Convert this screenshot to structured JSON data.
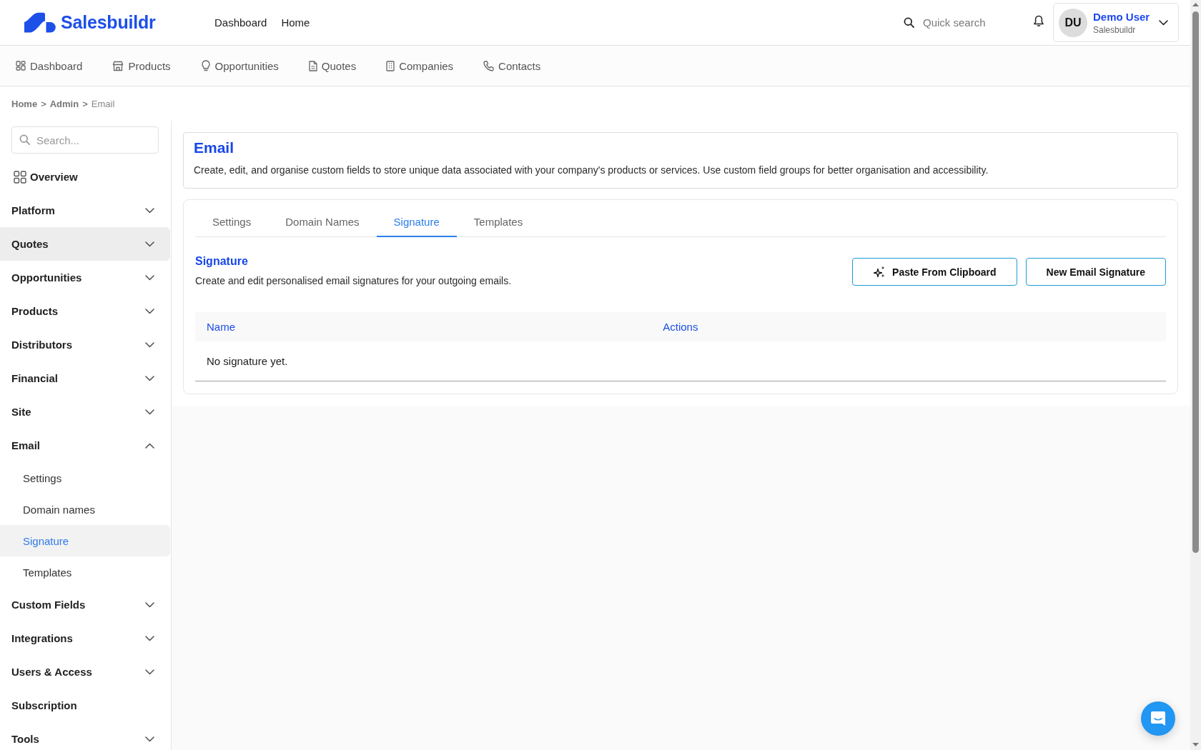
{
  "header": {
    "logo_text": "Salesbuildr",
    "nav": [
      {
        "label": "Dashboard"
      },
      {
        "label": "Home"
      }
    ],
    "search": {
      "placeholder": "Quick search"
    },
    "user": {
      "initials": "DU",
      "name": "Demo User",
      "organization": "Salesbuildr"
    }
  },
  "main_nav": [
    {
      "label": "Dashboard"
    },
    {
      "label": "Products"
    },
    {
      "label": "Opportunities"
    },
    {
      "label": "Quotes"
    },
    {
      "label": "Companies"
    },
    {
      "label": "Contacts"
    }
  ],
  "breadcrumb": [
    {
      "kind": "link",
      "text": "Home"
    },
    {
      "kind": "separator",
      "text": ">"
    },
    {
      "kind": "link",
      "text": "Admin"
    },
    {
      "kind": "separator",
      "text": ">"
    },
    {
      "kind": "current",
      "text": "Email"
    }
  ],
  "sidebar": {
    "search": {
      "placeholder": "Search..."
    },
    "overview": {
      "label": "Overview"
    },
    "items": [
      {
        "kind": "group",
        "label": "Platform",
        "expanded": false,
        "hovered": false
      },
      {
        "kind": "group",
        "label": "Quotes",
        "expanded": false,
        "hovered": true
      },
      {
        "kind": "group",
        "label": "Opportunities",
        "expanded": false,
        "hovered": false
      },
      {
        "kind": "group",
        "label": "Products",
        "expanded": false,
        "hovered": false
      },
      {
        "kind": "group",
        "label": "Distributors",
        "expanded": false,
        "hovered": false
      },
      {
        "kind": "group",
        "label": "Financial",
        "expanded": false,
        "hovered": false
      },
      {
        "kind": "group",
        "label": "Site",
        "expanded": false,
        "hovered": false
      },
      {
        "kind": "group",
        "label": "Email",
        "expanded": true,
        "hovered": false,
        "children": [
          {
            "label": "Settings",
            "selected": false
          },
          {
            "label": "Domain names",
            "selected": false
          },
          {
            "label": "Signature",
            "selected": true
          },
          {
            "label": "Templates",
            "selected": false
          }
        ]
      },
      {
        "kind": "group",
        "label": "Custom Fields",
        "expanded": false,
        "hovered": false
      },
      {
        "kind": "group",
        "label": "Integrations",
        "expanded": false,
        "hovered": false
      },
      {
        "kind": "group",
        "label": "Users & Access",
        "expanded": false,
        "hovered": false
      },
      {
        "kind": "link",
        "label": "Subscription",
        "hovered": false
      },
      {
        "kind": "group",
        "label": "Tools",
        "expanded": false,
        "hovered": false
      }
    ]
  },
  "page_header": {
    "title": "Email",
    "description": "Create, edit, and organise custom fields to store unique data associated with your company's products or services. Use custom field groups for better organisation and accessibility."
  },
  "tabs": [
    {
      "label": "Settings",
      "selected": false
    },
    {
      "label": "Domain Names",
      "selected": false
    },
    {
      "label": "Signature",
      "selected": true
    },
    {
      "label": "Templates",
      "selected": false
    }
  ],
  "section": {
    "title": "Signature",
    "description": "Create and edit personalised email signatures for your outgoing emails.",
    "buttons": [
      {
        "kind": "with_icon",
        "label": "Paste From Clipboard"
      },
      {
        "kind": "plain",
        "label": "New Email Signature"
      }
    ]
  },
  "table": {
    "columns": [
      "Name",
      "Actions"
    ],
    "empty_message": "No signature yet."
  }
}
